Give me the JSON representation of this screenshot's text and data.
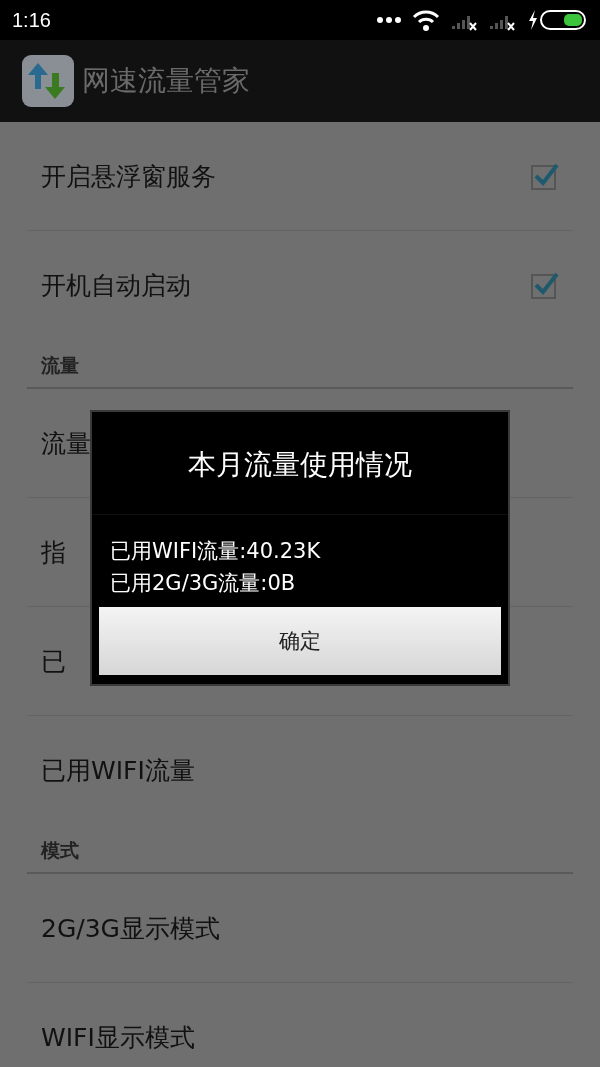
{
  "status_bar": {
    "time": "1:16"
  },
  "action_bar": {
    "title": "网速流量管家"
  },
  "list": [
    {
      "kind": "checkbox",
      "label": "开启悬浮窗服务",
      "checked": true
    },
    {
      "kind": "checkbox",
      "label": "开机自动启动",
      "checked": true
    },
    {
      "kind": "header",
      "label": "流量"
    },
    {
      "kind": "item",
      "label": "流量"
    },
    {
      "kind": "item",
      "label": "指"
    },
    {
      "kind": "item",
      "label": "已"
    },
    {
      "kind": "item",
      "label": "已用WIFI流量"
    },
    {
      "kind": "header",
      "label": "模式"
    },
    {
      "kind": "item",
      "label": "2G/3G显示模式"
    },
    {
      "kind": "item",
      "label": "WIFI显示模式"
    }
  ],
  "dialog": {
    "title": "本月流量使用情况",
    "message": [
      "已用WIFI流量:40.23K",
      "已用2G/3G流量:0B"
    ],
    "button": "确定"
  }
}
